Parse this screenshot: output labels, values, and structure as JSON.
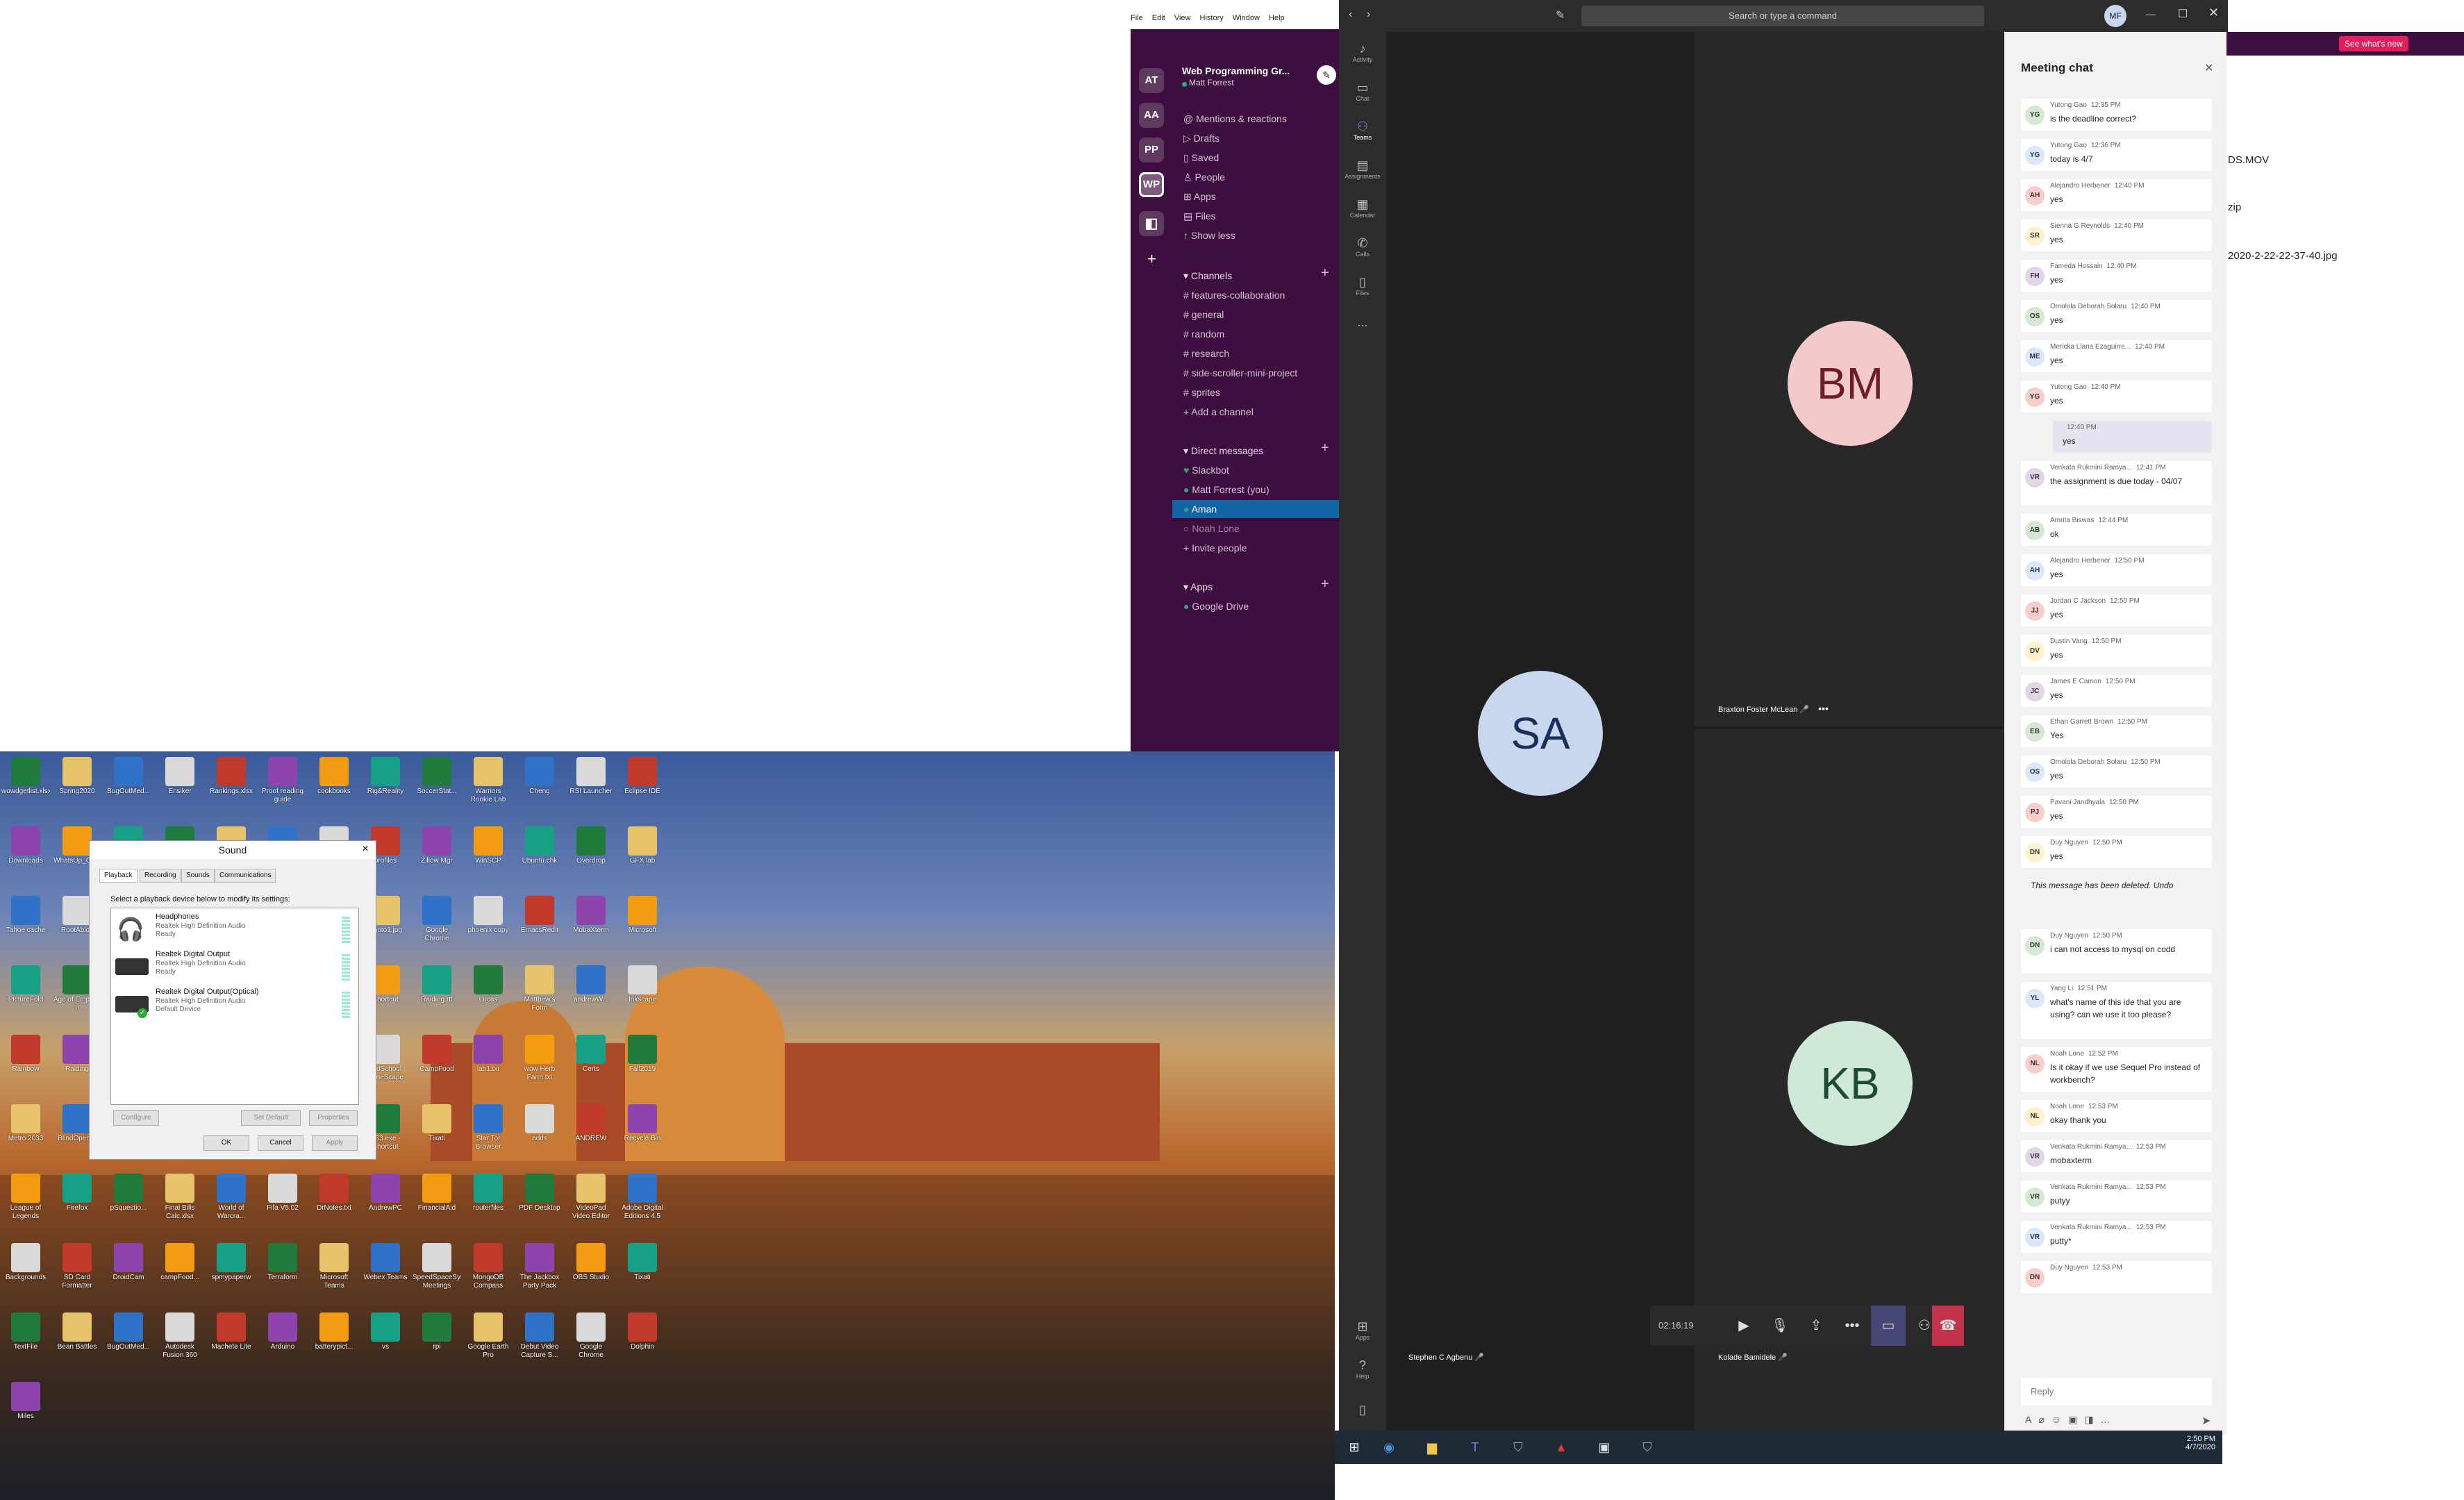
{
  "slack": {
    "menu": [
      "File",
      "Edit",
      "View",
      "History",
      "Window",
      "Help"
    ],
    "workspaces": [
      "AT",
      "AA",
      "PP",
      "WP"
    ],
    "workspace_name": "Web Programming Gr...",
    "user": "Matt Forrest",
    "nav": [
      "Mentions & reactions",
      "Drafts",
      "Saved",
      "People",
      "Apps",
      "Files",
      "Show less"
    ],
    "channels_header": "Channels",
    "channels": [
      "# features-collaboration",
      "# general",
      "# random",
      "# research",
      "# side-scroller-mini-project",
      "# sprites",
      "+ Add a channel"
    ],
    "dm_header": "Direct messages",
    "dms": [
      "Slackbot",
      "Matt Forrest  (you)",
      "Aman",
      "Noah Lone",
      "+ Invite people"
    ],
    "apps_header": "Apps",
    "apps": [
      "Google Drive"
    ]
  },
  "teams": {
    "search_placeholder": "Search or type a command",
    "user_initials": "MF",
    "rail": [
      "Activity",
      "Chat",
      "Teams",
      "Assignments",
      "Calendar",
      "Calls",
      "Files",
      "...",
      "Apps",
      "Help"
    ],
    "participants": [
      {
        "initials": "BM",
        "name": "Braxton Foster McLean"
      },
      {
        "initials": "SA",
        "name": "Stephen C Agbenu"
      },
      {
        "initials": "KB",
        "name": "Kolade Bamidele"
      }
    ],
    "timer": "02:16:19",
    "chat_title": "Meeting chat",
    "messages": [
      {
        "initials": "YG",
        "author": "Yutong Gao",
        "time": "12:35 PM",
        "text": "is the deadline correct?"
      },
      {
        "initials": "YG",
        "author": "Yutong Gao",
        "time": "12:36 PM",
        "text": "today is 4/7"
      },
      {
        "initials": "AH",
        "author": "Alejandro Herbener",
        "time": "12:40 PM",
        "text": "yes"
      },
      {
        "initials": "SR",
        "author": "Sienna G Reynolds",
        "time": "12:40 PM",
        "text": "yes"
      },
      {
        "initials": "FH",
        "author": "Fameda Hossain",
        "time": "12:40 PM",
        "text": "yes"
      },
      {
        "initials": "OS",
        "author": "Omolola Deborah Solaru",
        "time": "12:40 PM",
        "text": "yes"
      },
      {
        "initials": "ME",
        "author": "Mericka Llana Ezaguirre...",
        "time": "12:40 PM",
        "text": "yes"
      },
      {
        "initials": "YG",
        "author": "Yutong Gao",
        "time": "12:40 PM",
        "text": "yes"
      },
      {
        "initials": "",
        "author": "",
        "time": "12:40 PM",
        "text": "yes"
      },
      {
        "initials": "VR",
        "author": "Venkata Rukmini Ramya...",
        "time": "12:41 PM",
        "text": "the assignment is due today - 04/07"
      },
      {
        "initials": "AB",
        "author": "Amrita Biswas",
        "time": "12:44 PM",
        "text": "ok"
      },
      {
        "initials": "AH",
        "author": "Alejandro Herbener",
        "time": "12:50 PM",
        "text": "yes"
      },
      {
        "initials": "JJ",
        "author": "Jordan C Jackson",
        "time": "12:50 PM",
        "text": "yes"
      },
      {
        "initials": "DV",
        "author": "Dustin Vang",
        "time": "12:50 PM",
        "text": "yes"
      },
      {
        "initials": "JC",
        "author": "James E Camon",
        "time": "12:50 PM",
        "text": "yes"
      },
      {
        "initials": "EB",
        "author": "Ethan Garrett Brown",
        "time": "12:50 PM",
        "text": "Yes"
      },
      {
        "initials": "OS",
        "author": "Omolola Deborah Solaru",
        "time": "12:50 PM",
        "text": "yes"
      },
      {
        "initials": "PJ",
        "author": "Pavani Jandhyala",
        "time": "12:50 PM",
        "text": "yes"
      },
      {
        "initials": "DN",
        "author": "Duy Nguyen",
        "time": "12:50 PM",
        "text": "yes"
      },
      {
        "initials": "",
        "author": "",
        "time": "",
        "text": "This message has been deleted. Undo"
      },
      {
        "initials": "DN",
        "author": "Duy Nguyen",
        "time": "12:50 PM",
        "text": "i can not access to mysql on codd"
      },
      {
        "initials": "YL",
        "author": "Yang Li",
        "time": "12:51 PM",
        "text": "what's name of this ide that you are using? can we use it too please?"
      },
      {
        "initials": "NL",
        "author": "Noah Lone",
        "time": "12:52 PM",
        "text": "Is it okay if we use Sequel Pro instead of workbench?"
      },
      {
        "initials": "NL",
        "author": "Noah Lone",
        "time": "12:53 PM",
        "text": "okay thank you"
      },
      {
        "initials": "VR",
        "author": "Venkata Rukmini Ramya...",
        "time": "12:53 PM",
        "text": "mobaxterm"
      },
      {
        "initials": "VR",
        "author": "Venkata Rukmini Ramya...",
        "time": "12:53 PM",
        "text": "putyy"
      },
      {
        "initials": "VR",
        "author": "Venkata Rukmini Ramya...",
        "time": "12:53 PM",
        "text": "putty*"
      },
      {
        "initials": "DN",
        "author": "Duy Nguyen",
        "time": "12:53 PM",
        "text": ""
      }
    ],
    "reply_placeholder": "Reply"
  },
  "right_app": {
    "whats_new": "See what's new",
    "files": [
      "DS.MOV",
      "zip",
      "2020-2-22-22-37-40.jpg"
    ]
  },
  "sound_dialog": {
    "title": "Sound",
    "tabs": [
      "Playback",
      "Recording",
      "Sounds",
      "Communications"
    ],
    "instruction": "Select a playback device below to modify its settings:",
    "devices": [
      {
        "name": "Headphones",
        "driver": "Realtek High Definition Audio",
        "status": "Ready"
      },
      {
        "name": "Realtek Digital Output",
        "driver": "Realtek High Definition Audio",
        "status": "Ready"
      },
      {
        "name": "Realtek Digital Output(Optical)",
        "driver": "Realtek High Definition Audio",
        "status": "Default Device"
      }
    ],
    "buttons": {
      "configure": "Configure",
      "set_default": "Set Default",
      "properties": "Properties",
      "ok": "OK",
      "cancel": "Cancel",
      "apply": "Apply"
    }
  },
  "desktop_icons": [
    "wowdgetlist.xlsx",
    "Spring2020",
    "BugOutMed...",
    "Ensiker",
    "Rankings.xlsx",
    "Proof reading guide",
    "cookbooks",
    "Rig&Reality",
    "SoccerStat...",
    "Warriors Rookie Lab",
    "Cheng",
    "RSI Launcher",
    "Eclipse IDE",
    "Downloads",
    "WhatsUp_Gold",
    "Marvelous",
    "Google Chrome",
    "Folder",
    "Sales",
    "Tables",
    "profiles",
    "Zillow Mgr",
    "WinSCP",
    "Ubuntu.chk",
    "Overdrop",
    "GFX lab",
    "Tahoe cache",
    "RootAbloy",
    "pnpm",
    "Skype",
    "Zoom Cloud Meetings",
    "Pink brave",
    "Stardust",
    "Photo1.jpg",
    "Google Chrome",
    "phoenix copy",
    "EmacsRedit",
    "MobaXterm",
    "Microsoft",
    "PictureFold",
    "Age of Empires II",
    "Recycle Bin",
    "Atlanta Cyber Fiscal & H...",
    "Debit Card",
    "Jester",
    "gold",
    "Shortcut",
    "Raiding.rtf",
    "Lucas",
    "Matthew's Form",
    "andrewW...",
    "Inkscape",
    "Rainbow",
    "Raiding",
    "MatthewFo...",
    "Matthew ScorTimes",
    "Teamviewer",
    "2019_0821_...",
    "insurance.xls",
    "OldSchool RuneScape",
    "CampFood",
    "lab1.txt",
    "wow Herb Farm.txt",
    "Certs",
    "Fall2019",
    "Metro 2033",
    "BlindOpener",
    "eve of paperform",
    "beach.xlsx",
    "Kicks",
    "CampFood",
    "RealTemp - Shortcut",
    "TS3.exe - Shortcut",
    "Tixati",
    "Star Tor Browser",
    "adds",
    "ANDREW",
    "Recycle Bin",
    "League of Legends",
    "Firefox",
    "pSquestio...",
    "Final Bills Calc.xlsx",
    "World of Warcra...",
    "Fifa V5.02",
    "DrNotes.txt",
    "AndrewPC",
    "FinancialAid",
    "routerfiles",
    "PDF Desktop",
    "VideoPad Video Editor",
    "Adobe Digital Editions 4.5",
    "Backgrounds",
    "SD Card Formatter",
    "DroidCam",
    "campFood...",
    "spmypaperw",
    "Terraform",
    "Microsoft Teams",
    "Webex Teams",
    "SpeedSpaceSyn Meetings",
    "MongoDB Compass",
    "The Jackbox Party Pack",
    "OBS Studio",
    "Tixati",
    "TextFile",
    "Bean Battles",
    "BugOutMed...",
    "Autodesk Fusion 360",
    "Machete Lite",
    "Arduino",
    "batterypict...",
    "vs",
    "rpi",
    "Google Earth Pro",
    "Debut Video Capture S...",
    "Google Chrome",
    "Dolphin",
    "Miles"
  ],
  "colors": {
    "slack_bg": "#3f0e40",
    "teams_bg": "#1f1f1f",
    "bm_avatar": "#f4c9cc",
    "sa_avatar": "#c9d7ee",
    "kb_avatar": "#cfe8d7",
    "hangup": "#c4314b"
  },
  "taskbar": {
    "time": "2:50 PM",
    "date": "4/7/2020"
  }
}
